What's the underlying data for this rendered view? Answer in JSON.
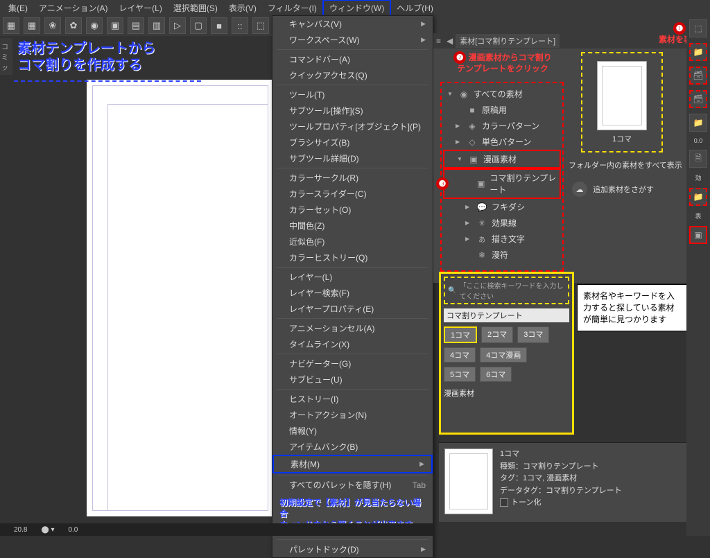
{
  "menubar": {
    "items": [
      {
        "label": "集(E)"
      },
      {
        "label": "アニメーション(A)"
      },
      {
        "label": "レイヤー(L)"
      },
      {
        "label": "選択範囲(S)"
      },
      {
        "label": "表示(V)"
      },
      {
        "label": "フィルター(I)"
      },
      {
        "label": "ウィンドウ(W)",
        "highlight": true
      },
      {
        "label": "ヘルプ(H)"
      }
    ]
  },
  "toolbar_icons": [
    "▦",
    "▦",
    "❀",
    "✿",
    "◉",
    "▣",
    "▤",
    "▥",
    "▷",
    "▢",
    "■",
    "::",
    "⬚",
    "✕",
    "⬚"
  ],
  "left_tab": "コミッ",
  "blue_title": "素材テンプレートから\nコマ割りを作成する",
  "window_menu": {
    "items": [
      {
        "label": "キャンバス(V)",
        "sub": true
      },
      {
        "label": "ワークスペース(W)",
        "sub": true
      },
      {
        "sep": true
      },
      {
        "label": "コマンドバー(A)"
      },
      {
        "label": "クイックアクセス(Q)"
      },
      {
        "sep": true
      },
      {
        "label": "ツール(T)"
      },
      {
        "label": "サブツール[操作](S)"
      },
      {
        "label": "ツールプロパティ[オブジェクト](P)"
      },
      {
        "label": "ブラシサイズ(B)"
      },
      {
        "label": "サブツール詳細(D)"
      },
      {
        "sep": true
      },
      {
        "label": "カラーサークル(R)"
      },
      {
        "label": "カラースライダー(C)"
      },
      {
        "label": "カラーセット(O)"
      },
      {
        "label": "中間色(Z)"
      },
      {
        "label": "近似色(F)"
      },
      {
        "label": "カラーヒストリー(Q)"
      },
      {
        "sep": true
      },
      {
        "label": "レイヤー(L)"
      },
      {
        "label": "レイヤー検索(F)"
      },
      {
        "label": "レイヤープロパティ(E)"
      },
      {
        "sep": true
      },
      {
        "label": "アニメーションセル(A)"
      },
      {
        "label": "タイムライン(X)"
      },
      {
        "sep": true
      },
      {
        "label": "ナビゲーター(G)"
      },
      {
        "label": "サブビュー(U)"
      },
      {
        "sep": true
      },
      {
        "label": "ヒストリー(I)"
      },
      {
        "label": "オートアクション(N)"
      },
      {
        "label": "情報(Y)"
      },
      {
        "label": "アイテムバンク(B)"
      },
      {
        "label": "素材(M)",
        "sub": true,
        "bluebox": true
      },
      {
        "sep": true
      },
      {
        "label": "すべてのパレットを隠す(H)",
        "shortcut": "Tab"
      }
    ],
    "note": "初期設定で【素材】が見当たらない場合\nウィンドウから開くことが出来ます",
    "after": [
      {
        "sep": true
      },
      {
        "label": "パレットドック(D)",
        "sub": true
      }
    ]
  },
  "material": {
    "tab": "素材[コマ割りテンプレート]",
    "anno2_badge": "❷",
    "anno2_text": "漫画素材からコマ割り\nテンプレートをクリック",
    "anno1_badge": "❶",
    "anno1_text": "素材を表示",
    "tree": [
      {
        "tri": "▼",
        "icon": "◉",
        "label": "すべての素材",
        "lvl0": true
      },
      {
        "icon": "■",
        "label": "原稿用"
      },
      {
        "tri": "▶",
        "icon": "◈",
        "label": "カラーパターン"
      },
      {
        "tri": "▶",
        "icon": "◇",
        "label": "単色パターン"
      },
      {
        "tri": "▼",
        "icon": "▣",
        "label": "漫画素材",
        "redbox": true
      },
      {
        "icon": "▣",
        "label": "コマ割りテンプレート",
        "lvl2": true,
        "redbox": true,
        "badge": "❸"
      },
      {
        "tri": "▶",
        "icon": "💬",
        "label": "フキダシ",
        "lvl2": true
      },
      {
        "tri": "▶",
        "icon": "✳",
        "label": "効果線",
        "lvl2": true
      },
      {
        "tri": "▶",
        "icon": "ぁ",
        "label": "描き文字",
        "lvl2": true
      },
      {
        "icon": "❄",
        "label": "漫符",
        "lvl2": true
      }
    ],
    "thumb_label": "1コマ",
    "folder_label": "フォルダー内の素材をすべて表示",
    "extra_label": "追加素材をさがす"
  },
  "search": {
    "placeholder": "「ここに検索キーワードを入力してください",
    "bar_label": "コマ割りテンプレート",
    "tags_row1": [
      "1コマ",
      "2コマ",
      "3コマ"
    ],
    "tags_row2": [
      "4コマ",
      "4コマ漫画"
    ],
    "tags_row3": [
      "5コマ",
      "6コマ"
    ],
    "plain": "漫画素材"
  },
  "callout_text": "素材名やキーワードを入力すると探している素材が簡単に見つかります",
  "detail": {
    "name_label": "1コマ",
    "kind_label": "種類：コマ割りテンプレート",
    "tag_label": "タグ：1コマ, 漫画素材",
    "datatag_label": "データタグ：コマ割りテンプレート",
    "tone_label": "トーン化"
  },
  "right_rail_icons": [
    "⬚",
    "📁",
    "🗃",
    "🗃",
    "📁",
    "🗎",
    "📁",
    "▣"
  ],
  "right_small": [
    "0.0",
    "効",
    "表"
  ],
  "status": {
    "zoom": "20.8",
    "pos": "0.0"
  }
}
